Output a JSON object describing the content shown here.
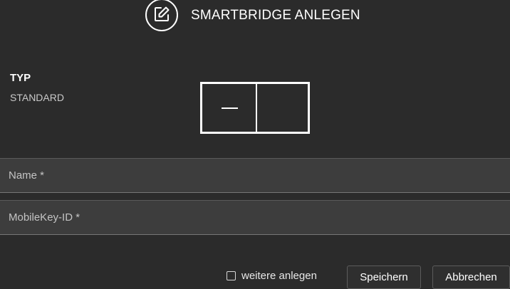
{
  "header": {
    "title": "SMARTBRIDGE ANLEGEN",
    "icon": "edit-icon"
  },
  "type": {
    "label": "TYP",
    "value": "STANDARD"
  },
  "form": {
    "name_placeholder": "Name *",
    "name_value": "",
    "mobilekey_placeholder": "MobileKey-ID *",
    "mobilekey_value": ""
  },
  "footer": {
    "checkbox_label": "weitere anlegen",
    "checkbox_checked": false,
    "save_label": "Speichern",
    "cancel_label": "Abbrechen"
  },
  "colors": {
    "background": "#2b2b2b",
    "field_background": "#3d3d3d",
    "text": "#ffffff",
    "muted_text": "#c9c9c9"
  }
}
